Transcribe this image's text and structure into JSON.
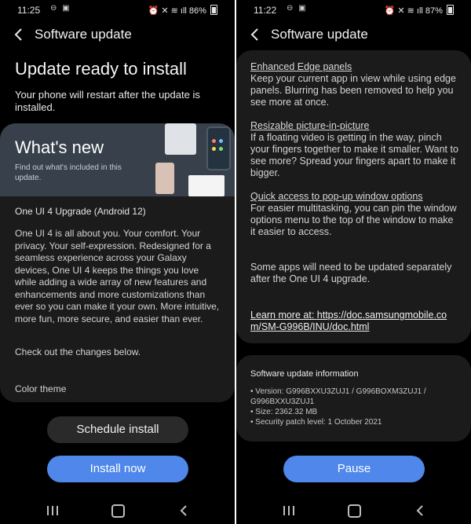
{
  "left": {
    "status": {
      "time": "11:25",
      "battery": "86%"
    },
    "header": {
      "title": "Software update"
    },
    "ready_title": "Update ready to install",
    "restart_note": "Your phone will restart after the update is installed.",
    "whats_new": {
      "title": "What's new",
      "subtitle": "Find out what's included in this update."
    },
    "upgrade_title": "One UI 4 Upgrade (Android 12)",
    "description": "One UI 4 is all about you. Your comfort. Your privacy. Your self-expression. Redesigned for a seamless experience across your Galaxy devices, One UI 4 keeps the things you love while adding a wide array of new features and enhancements and more customizations than ever so you can make it your own. More intuitive, more fun, more secure, and easier than ever.",
    "check_out": "Check out the changes below.",
    "color_theme": "Color theme",
    "buttons": {
      "schedule": "Schedule install",
      "install": "Install now"
    }
  },
  "right": {
    "status": {
      "time": "11:22",
      "battery": "87%"
    },
    "header": {
      "title": "Software update"
    },
    "features": [
      {
        "heading": "Enhanced Edge panels",
        "body": "Keep your current app in view while using edge panels. Blurring has been removed to help you see more at once."
      },
      {
        "heading": "Resizable picture-in-picture",
        "body": "If a floating video is getting in the way, pinch your fingers together to make it smaller. Want to see more? Spread your fingers apart to make it bigger."
      },
      {
        "heading": "Quick access to pop-up window options",
        "body": "For easier multitasking, you can pin the window options menu to the top of the window to make it easier to access."
      }
    ],
    "apps_note": "Some apps will need to be updated separately after the One UI 4 upgrade.",
    "learn_more": {
      "prefix": "Learn more at: ",
      "url": "https://doc.samsungmobile.com/SM-G996B/INU/doc.html"
    },
    "info": {
      "title": "Software update information",
      "items": [
        "• Version: G996BXXU3ZUJ1 / G996BOXM3ZUJ1 / G996BXXU3ZUJ1",
        "• Size: 2362.32 MB",
        "• Security patch level: 1 October 2021"
      ]
    },
    "buttons": {
      "pause": "Pause"
    }
  },
  "colors": {
    "accent": "#4f87ea",
    "card": "#1b1b1b",
    "banner": "#37404b",
    "background": "#000000"
  },
  "icons": [
    "back-arrow-icon",
    "recent-apps-icon",
    "home-icon",
    "nav-back-icon",
    "alarm-icon",
    "mute-icon",
    "wifi-icon",
    "signal-icon",
    "battery-icon"
  ]
}
